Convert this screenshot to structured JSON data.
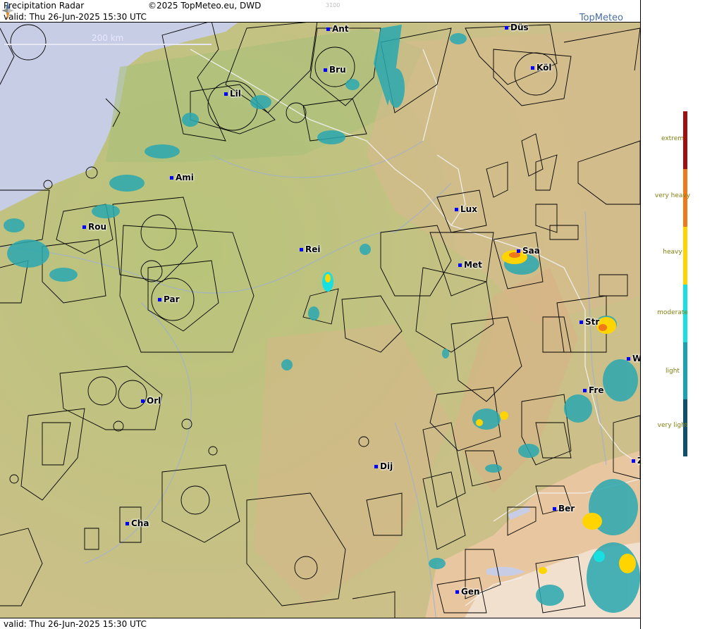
{
  "header": {
    "title": "Precipitation Radar",
    "copyright": "©2025 TopMeteo.eu, DWD",
    "valid": "valid:  Thu  26-Jun-2025 15:30 UTC",
    "faint_code": "3100"
  },
  "brand": "TopMeteo",
  "scale_label": "200 km",
  "footer": {
    "valid": "valid:  Thu  26-Jun-2025 15:30 UTC"
  },
  "cities": [
    {
      "name": "Ant"
    },
    {
      "name": "Düs"
    },
    {
      "name": "Bru"
    },
    {
      "name": "Köl"
    },
    {
      "name": "Lil"
    },
    {
      "name": "Ami"
    },
    {
      "name": "Lux"
    },
    {
      "name": "Rou"
    },
    {
      "name": "Rei"
    },
    {
      "name": "Saa"
    },
    {
      "name": "Met"
    },
    {
      "name": "Par"
    },
    {
      "name": "Str"
    },
    {
      "name": "W"
    },
    {
      "name": "Fre"
    },
    {
      "name": "Orl"
    },
    {
      "name": "Dij"
    },
    {
      "name": "Z"
    },
    {
      "name": "Ber"
    },
    {
      "name": "Cha"
    },
    {
      "name": "Gen"
    }
  ],
  "legend": {
    "levels": [
      {
        "label": "extrem",
        "color": "#a01010"
      },
      {
        "label": "very heavy",
        "color": "#f07a1a"
      },
      {
        "label": "heavy",
        "color": "#ffd400"
      },
      {
        "label": "moderate",
        "color": "#18e0e0"
      },
      {
        "label": "light",
        "color": "#1aa0b0"
      },
      {
        "label": "very light",
        "color": "#10506a"
      }
    ]
  },
  "colors": {
    "land": "#c9c08e",
    "sea": "#c8cde6",
    "alps": "#e8c7a0",
    "radar_light": "#2aa8b0",
    "radar_heavy": "#ffd400"
  }
}
